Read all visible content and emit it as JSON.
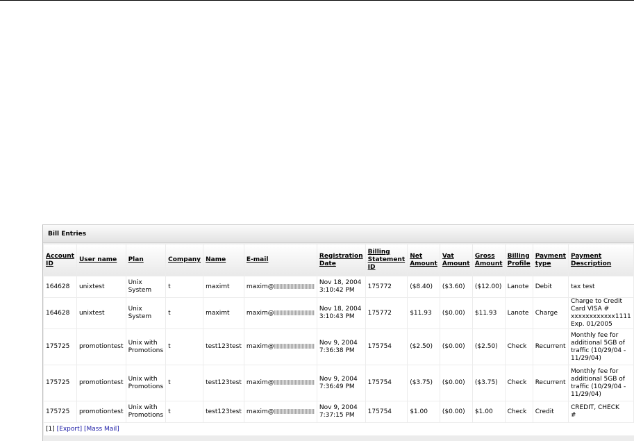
{
  "panel": {
    "title": "Bill Entries"
  },
  "columns": [
    [
      "Account",
      "ID"
    ],
    [
      "User name"
    ],
    [
      "Plan"
    ],
    [
      "Company"
    ],
    [
      "Name"
    ],
    [
      "E-mail"
    ],
    [
      "Registration",
      "Date"
    ],
    [
      "Billing",
      "Statement",
      "ID"
    ],
    [
      "Net",
      "Amount"
    ],
    [
      "Vat",
      "Amount"
    ],
    [
      "Gross",
      "Amount"
    ],
    [
      "Billing",
      "Profile"
    ],
    [
      "Payment",
      "type"
    ],
    [
      "Payment",
      "Description"
    ]
  ],
  "rows": [
    {
      "account_id": "164628",
      "user": "unixtest",
      "plan": [
        "Unix",
        "System"
      ],
      "company": "t",
      "name": "maximt",
      "email_prefix": "maxim@",
      "date": [
        "Nov 18, 2004",
        "3:10:42 PM"
      ],
      "statement": "175772",
      "net": "($8.40)",
      "vat": "($3.60)",
      "gross": "($12.00)",
      "profile": "Lanote",
      "type": "Debit",
      "desc": [
        "tax test"
      ]
    },
    {
      "account_id": "164628",
      "user": "unixtest",
      "plan": [
        "Unix",
        "System"
      ],
      "company": "t",
      "name": "maximt",
      "email_prefix": "maxim@",
      "date": [
        "Nov 18, 2004",
        "3:10:43 PM"
      ],
      "statement": "175772",
      "net": "$11.93",
      "vat": "($0.00)",
      "gross": "$11.93",
      "profile": "Lanote",
      "type": "Charge",
      "desc": [
        "Charge to Credit",
        "Card VISA #",
        "xxxxxxxxxxxx1111",
        "Exp. 01/2005"
      ]
    },
    {
      "account_id": "175725",
      "user": "promotiontest",
      "plan": [
        "Unix with",
        "Promotions"
      ],
      "company": "t",
      "name": "test123test",
      "email_prefix": "maxim@",
      "date": [
        "Nov 9, 2004",
        "7:36:38 PM"
      ],
      "statement": "175754",
      "net": "($2.50)",
      "vat": "($0.00)",
      "gross": "($2.50)",
      "profile": "Check",
      "type": "Recurrent",
      "desc": [
        "Monthly fee for",
        "additional 5GB of",
        "traffic (10/29/04 -",
        "11/29/04)"
      ]
    },
    {
      "account_id": "175725",
      "user": "promotiontest",
      "plan": [
        "Unix with",
        "Promotions"
      ],
      "company": "t",
      "name": "test123test",
      "email_prefix": "maxim@",
      "date": [
        "Nov 9, 2004",
        "7:36:49 PM"
      ],
      "statement": "175754",
      "net": "($3.75)",
      "vat": "($0.00)",
      "gross": "($3.75)",
      "profile": "Check",
      "type": "Recurrent",
      "desc": [
        "Monthly fee for",
        "additional 5GB of",
        "traffic (10/29/04 -",
        "11/29/04)"
      ]
    },
    {
      "account_id": "175725",
      "user": "promotiontest",
      "plan": [
        "Unix with",
        "Promotions"
      ],
      "company": "t",
      "name": "test123test",
      "email_prefix": "maxim@",
      "date": [
        "Nov 9, 2004",
        "7:37:15 PM"
      ],
      "statement": "175754",
      "net": "$1.00",
      "vat": "($0.00)",
      "gross": "$1.00",
      "profile": "Check",
      "type": "Credit",
      "desc": [
        "CREDIT, CHECK",
        "#"
      ]
    }
  ],
  "footer": {
    "page": "[1]",
    "export": "[Export]",
    "mass_mail": "[Mass Mail]"
  }
}
